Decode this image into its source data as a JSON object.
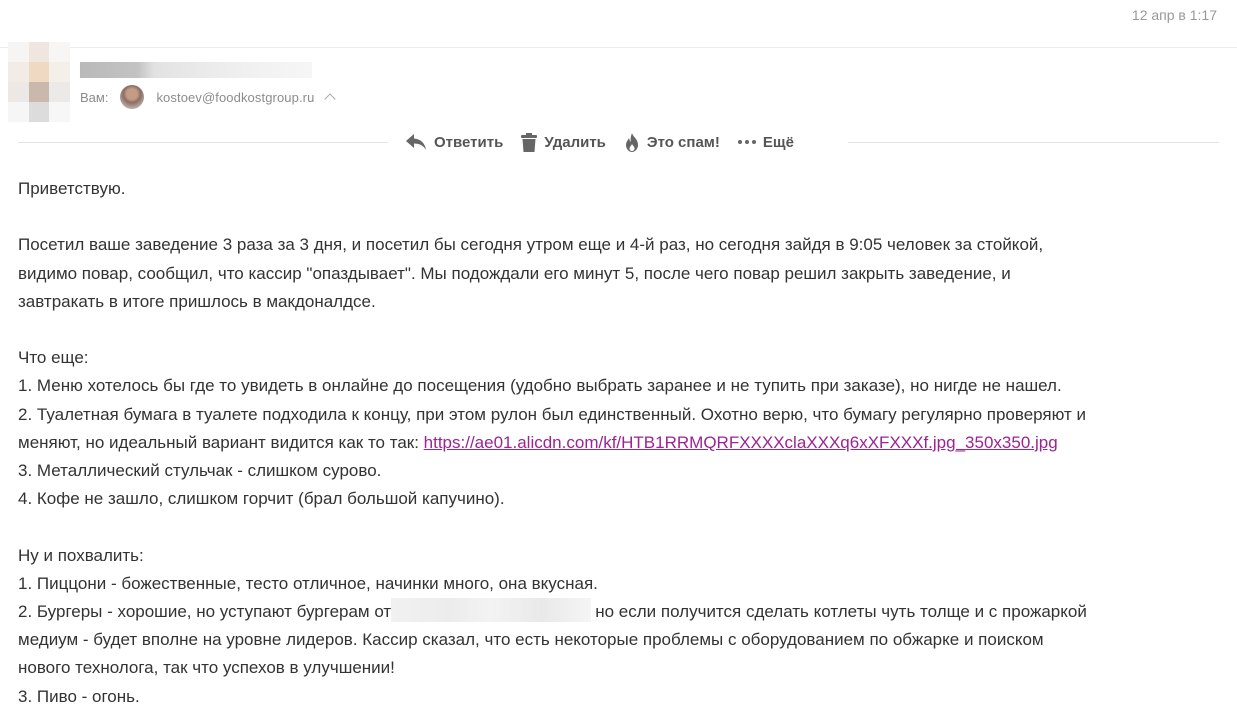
{
  "header": {
    "date": "12 апр в 1:17",
    "to_label": "Вам:",
    "to_email": "kostoev@foodkostgroup.ru"
  },
  "toolbar": {
    "reply": "Ответить",
    "delete": "Удалить",
    "spam": "Это спам!",
    "more": "Ещё"
  },
  "colors": {
    "link": "#9c2393",
    "text": "#333333",
    "muted": "#999999"
  },
  "message": {
    "greeting": "Приветствую.",
    "p1_l1": "Посетил ваше заведение 3 раза за 3 дня, и посетил бы сегодня утром еще и 4-й раз, но сегодня зайдя в 9:05 человек за стойкой,",
    "p1_l2": "видимо повар, сообщил, что кассир \"опаздывает\". Мы подождали его минут 5, после чего повар решил закрыть заведение, и",
    "p1_l3": "завтракать в итоге пришлось в макдоналдсе.",
    "what_else": "Что еще:",
    "c1": "1. Меню хотелось бы где то увидеть в онлайне до посещения (удобно выбрать заранее и не тупить при заказе), но нигде не нашел.",
    "c2_l1": "2. Туалетная бумага в туалете подходила к концу, при этом рулон был единственный. Охотно верю, что бумагу регулярно проверяют и",
    "c2_l2_pre": "меняют, но идеальный вариант видится как то так: ",
    "c2_link": "https://ae01.alicdn.com/kf/HTB1RRMQRFXXXXclaXXXq6xXFXXXf.jpg_350x350.jpg",
    "c3": "3. Металлический стульчак - слишком сурово.",
    "c4": "4. Кофе не зашло, слишком горчит (брал большой капучино).",
    "praise": "Ну и похвалить:",
    "g1": "1. Пиццони - божественные, тесто отличное, начинки много, она вкусная.",
    "g2_l1_pre": "2. Бургеры - хорошие, но уступают бургерам от",
    "g2_l1_post": "но если получится сделать котлеты чуть толще и с прожаркой",
    "g2_l2": "медиум - будет вполне на уровне лидеров. Кассир сказал, что есть некоторые проблемы с оборудованием по обжарке и поиском",
    "g2_l3": "нового технолога, так что успехов в улучшении!",
    "g3": "3. Пиво - огонь."
  }
}
